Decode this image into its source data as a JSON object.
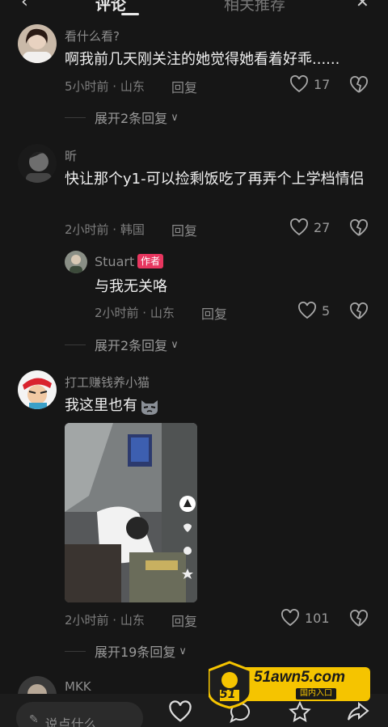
{
  "header": {
    "tab_1": "评论",
    "tab_2": "相关推荐"
  },
  "comments": [
    {
      "username": "看什么看?",
      "text": "啊我前几天刚关注的她觉得她看着好乖......",
      "time_location": "5小时前 · 山东",
      "reply_label": "回复",
      "likes": "17",
      "expand_label": "展开2条回复"
    },
    {
      "username": "昕",
      "text": "快让那个y1-可以捡剩饭吃了再弄个上学档情侣",
      "time_location": "2小时前 · 韩国",
      "reply_label": "回复",
      "likes": "27",
      "reply": {
        "username": "Stuart",
        "badge": "作者",
        "text": "与我无关咯",
        "time_location": "2小时前 · 山东",
        "reply_label": "回复",
        "likes": "5"
      },
      "expand_label": "展开2条回复"
    },
    {
      "username": "打工赚钱养小猫",
      "text": "我这里也有",
      "time_location": "2小时前 · 山东",
      "reply_label": "回复",
      "likes": "101",
      "expand_label": "展开19条回复"
    },
    {
      "username": "MKK"
    }
  ],
  "bottom_bar": {
    "input_placeholder": "说点什么..."
  },
  "watermark": {
    "brand": "51awn5.com",
    "tagline": "国内入口",
    "logo_number": "51"
  },
  "colors": {
    "background": "#161616",
    "author_badge": "#e8365f",
    "secondary_text": "#7d7d7d"
  }
}
